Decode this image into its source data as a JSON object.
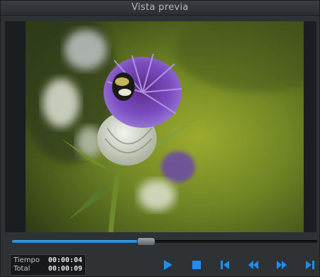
{
  "window": {
    "title": "Vista previa"
  },
  "playback": {
    "progress_fraction": 0.44
  },
  "time": {
    "elapsed_label": "Tiempo",
    "elapsed_value": "00:00:04",
    "total_label": "Total",
    "total_value": "00:00:09"
  },
  "controls": [
    {
      "name": "play-button",
      "icon": "play-icon"
    },
    {
      "name": "stop-button",
      "icon": "stop-icon"
    },
    {
      "name": "skip-to-start-button",
      "icon": "skip-start-icon"
    },
    {
      "name": "rewind-button",
      "icon": "rewind-icon"
    },
    {
      "name": "fast-forward-button",
      "icon": "fast-forward-icon"
    },
    {
      "name": "skip-to-end-button",
      "icon": "skip-end-icon"
    }
  ],
  "colors": {
    "accent": "#1e8ff0",
    "seek_fill": "#2a94d8"
  }
}
